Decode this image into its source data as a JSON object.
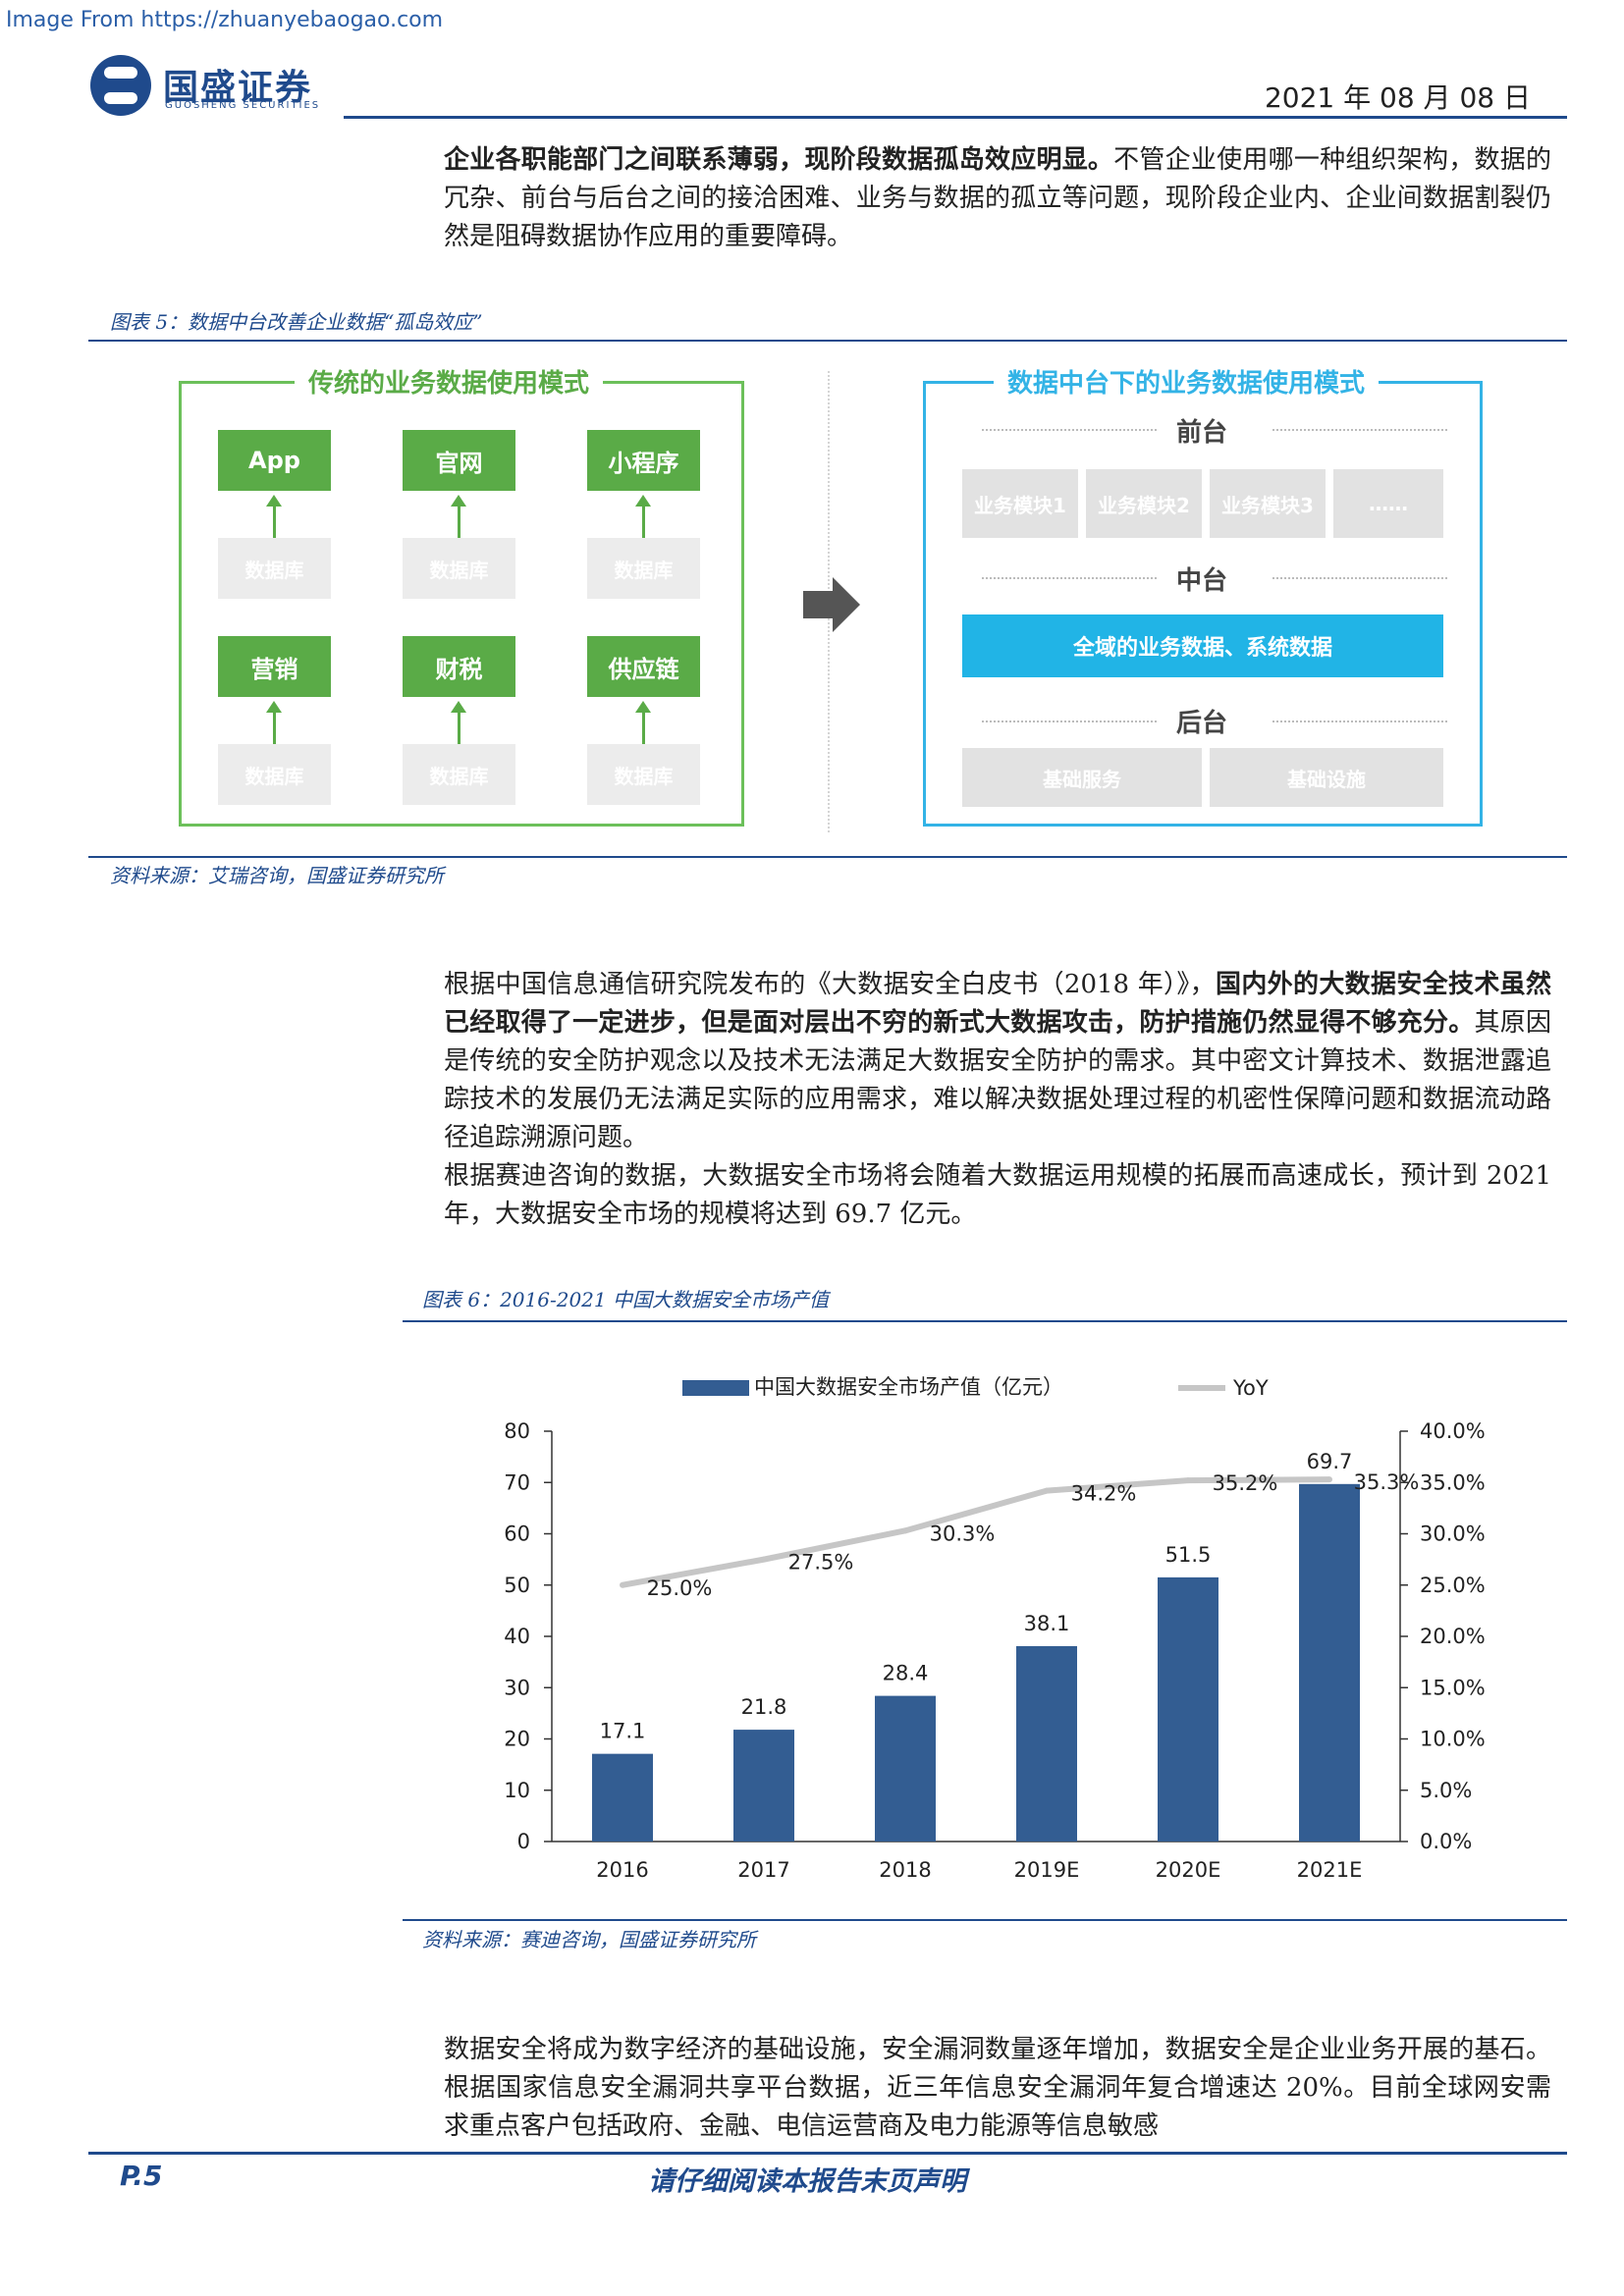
{
  "watermark": "Image From https://zhuanyebaogao.com",
  "header": {
    "brand": "国盛证券",
    "brand_sub": "GUOSHENG SECURITIES",
    "date": "2021 年 08 月 08 日"
  },
  "intro": {
    "bold": "企业各职能部门之间联系薄弱，现阶段数据孤岛效应明显。",
    "text": "不管企业使用哪一种组织架构，数据的冗杂、前台与后台之间的接洽困难、业务与数据的孤立等问题，现阶段企业内、企业间数据割裂仍然是阻碍数据协作应用的重要障碍。"
  },
  "figure5": {
    "caption": "图表 5：数据中台改善企业数据“孤岛效应”",
    "source": "资料来源：艾瑞咨询，国盛证券研究所",
    "left": {
      "title": "传统的业务数据使用模式",
      "apps": [
        "App",
        "官网",
        "小程序",
        "营销",
        "财税",
        "供应链"
      ],
      "db": "数据库"
    },
    "right": {
      "title": "数据中台下的业务数据使用模式",
      "front": "前台",
      "modules": [
        "业务模块1",
        "业务模块2",
        "业务模块3",
        "……"
      ],
      "middle": "中台",
      "middle_bar": "全域的业务数据、系统数据",
      "back": "后台",
      "back_items": [
        "基础服务",
        "基础设施"
      ]
    }
  },
  "para2": {
    "text1": "根据中国信息通信研究院发布的《大数据安全白皮书（2018 年）》，",
    "bold": "国内外的大数据安全技术虽然已经取得了一定进步，但是面对层出不穷的新式大数据攻击，防护措施仍然显得不够充分。",
    "text2": "其原因是传统的安全防护观念以及技术无法满足大数据安全防护的需求。其中密文计算技术、数据泄露追踪技术的发展仍无法满足实际的应用需求，难以解决数据处理过程的机密性保障问题和数据流动路径追踪溯源问题。"
  },
  "para3": "根据赛迪咨询的数据，大数据安全市场将会随着大数据运用规模的拓展而高速成长，预计到 2021 年，大数据安全市场的规模将达到 69.7 亿元。",
  "figure6": {
    "caption": "图表 6：2016-2021 中国大数据安全市场产值",
    "source": "资料来源：赛迪咨询，国盛证券研究所"
  },
  "chart_data": {
    "type": "bar",
    "categories": [
      "2016",
      "2017",
      "2018",
      "2019E",
      "2020E",
      "2021E"
    ],
    "series": [
      {
        "name": "中国大数据安全市场产值（亿元）",
        "kind": "bar",
        "axis": "left",
        "values": [
          17.1,
          21.8,
          28.4,
          38.1,
          51.5,
          69.7
        ],
        "labels": [
          "17.1",
          "21.8",
          "28.4",
          "38.1",
          "51.5",
          "69.7"
        ],
        "color": "#335d92"
      },
      {
        "name": "YoY",
        "kind": "line",
        "axis": "right",
        "values": [
          25.0,
          27.5,
          30.3,
          34.2,
          35.2,
          35.3
        ],
        "labels": [
          "25.0%",
          "27.5%",
          "30.3%",
          "34.2%",
          "35.2%",
          "35.3%"
        ],
        "color": "#c6c6c6"
      }
    ],
    "ylim": [
      0,
      80
    ],
    "y_ticks": [
      "0",
      "10",
      "20",
      "30",
      "40",
      "50",
      "60",
      "70",
      "80"
    ],
    "y2lim": [
      0,
      40
    ],
    "y2_ticks": [
      "0.0%",
      "5.0%",
      "10.0%",
      "15.0%",
      "20.0%",
      "25.0%",
      "30.0%",
      "35.0%",
      "40.0%"
    ],
    "legend": "top",
    "grid": false
  },
  "para4": "数据安全将成为数字经济的基础设施，安全漏洞数量逐年增加，数据安全是企业业务开展的基石。根据国家信息安全漏洞共享平台数据，近三年信息安全漏洞年复合增速达 20%。目前全球网安需求重点客户包括政府、金融、电信运营商及电力能源等信息敏感",
  "footer": {
    "page": "P.5",
    "note": "请仔细阅读本报告末页声明"
  }
}
